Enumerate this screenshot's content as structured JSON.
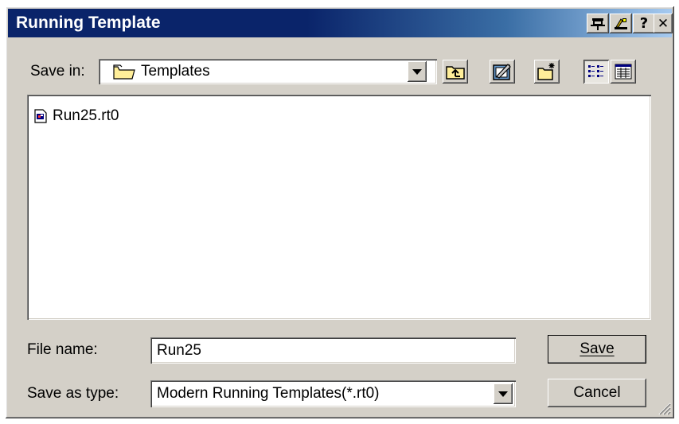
{
  "window": {
    "title": "Running Template",
    "title_buttons": {
      "pin_icon": "pin-icon",
      "wizard_icon": "wizard-icon",
      "help_label": "?",
      "close_label": "✕"
    }
  },
  "save_in": {
    "label": "Save in:",
    "value": "Templates",
    "icon": "folder-icon"
  },
  "toolbar": {
    "buttons": [
      "up-one-level",
      "edit",
      "create-new-folder",
      "list-view",
      "details-view"
    ],
    "active_view": "list-view"
  },
  "files": [
    {
      "name": "Run25.rt0",
      "icon": "template-file-icon"
    }
  ],
  "file_name": {
    "label": "File name:",
    "value": "Run25"
  },
  "save_as_type": {
    "label": "Save as type:",
    "value": "Modern Running Templates(*.rt0)"
  },
  "buttons": {
    "save_label": "Save",
    "cancel_label": "Cancel"
  },
  "colors": {
    "title_bar_start": "#0a246a",
    "title_bar_end": "#a6caf0",
    "face": "#d4d0c8"
  }
}
